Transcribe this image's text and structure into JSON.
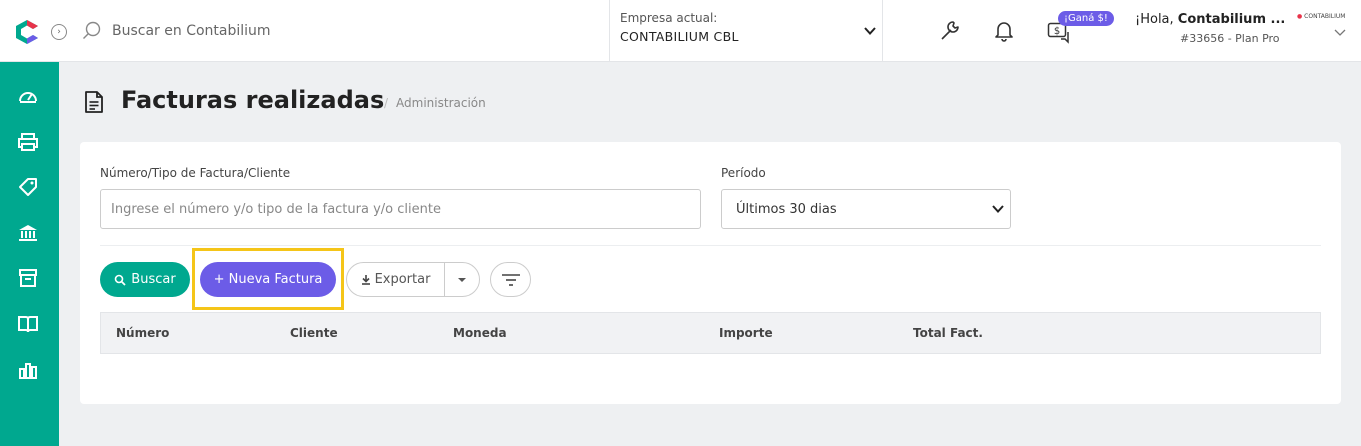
{
  "topbar": {
    "search_placeholder": "Buscar en Contabilium",
    "company_label": "Empresa actual:",
    "company_value": "CONTABILIUM CBL",
    "badge": "¡Ganá $!",
    "user_greeting_prefix": "¡Hola, ",
    "user_name": "Contabilium ...",
    "user_plan": "#33656 - Plan Pro",
    "user_logo_text": "CONTABILIUM"
  },
  "colors": {
    "primary": "#00a88f",
    "accent": "#6c5ce7",
    "highlight": "#f5c518"
  },
  "sidebar": {
    "items": [
      {
        "icon": "dashboard-icon"
      },
      {
        "icon": "printer-icon"
      },
      {
        "icon": "tag-icon"
      },
      {
        "icon": "bank-icon"
      },
      {
        "icon": "box-icon"
      },
      {
        "icon": "book-icon"
      },
      {
        "icon": "chart-icon"
      }
    ]
  },
  "page": {
    "title": "Facturas realizadas",
    "breadcrumb_sep": "/",
    "breadcrumb": "Administración"
  },
  "filters": {
    "query_label": "Número/Tipo de Factura/Cliente",
    "query_placeholder": "Ingrese el número y/o tipo de la factura y/o cliente",
    "period_label": "Período",
    "period_value": "Últimos 30 dias"
  },
  "actions": {
    "search": "Buscar",
    "new_invoice": "+ Nueva Factura",
    "export": "Exportar"
  },
  "table": {
    "columns": [
      "Número",
      "Cliente",
      "Moneda",
      "Importe",
      "Total Fact."
    ]
  }
}
